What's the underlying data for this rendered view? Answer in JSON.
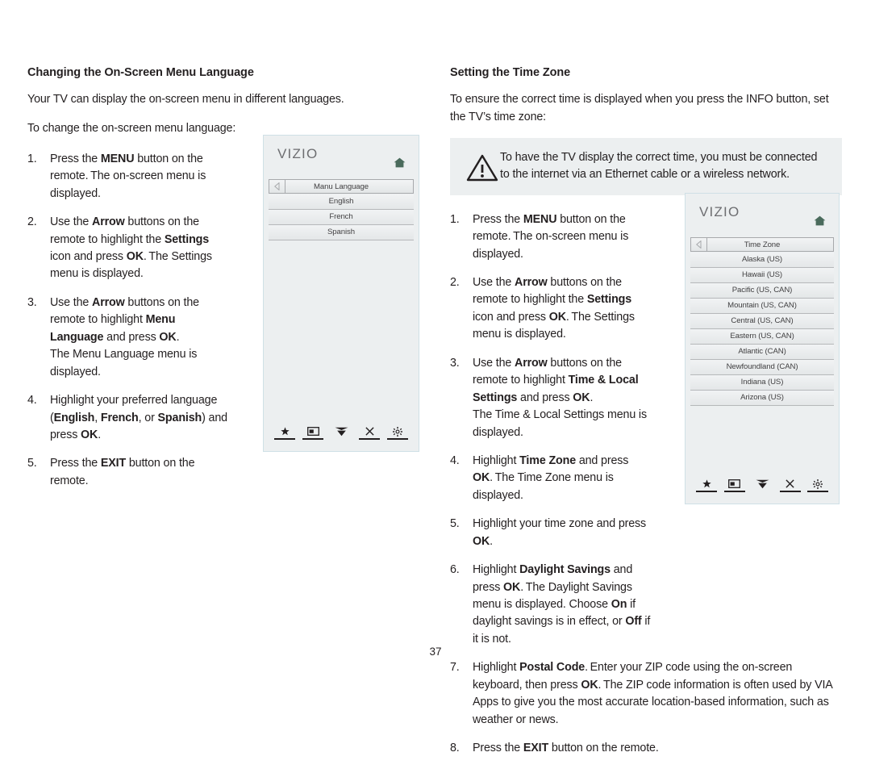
{
  "page": {
    "number": "37"
  },
  "left_column": {
    "title": "Changing the On-Screen Menu Language",
    "intro_1": "Your TV can display the on-screen menu in different languages.",
    "intro_2": "To change the on-screen menu language:",
    "steps": [
      {
        "num": "1.",
        "html": "Press the <b>MENU</b> button on the remote. The on-screen menu is displayed."
      },
      {
        "num": "2.",
        "html": "Use the <b>Arrow</b> buttons on the remote to highlight the <b>Settings</b> icon and press <b>OK</b>. The Settings menu is displayed."
      },
      {
        "num": "3.",
        "html": "Use the <b>Arrow</b> buttons on the remote to highlight <b>Menu Language</b> and press <b>OK</b>.<br>The Menu Language menu is displayed."
      },
      {
        "num": "4.",
        "html": "Highlight your preferred language (<b>English</b>, <b>French</b>, or <b>Spanish</b>) and press <b>OK</b>."
      },
      {
        "num": "5.",
        "html": "Press the <b>EXIT</b> button on the remote."
      }
    ]
  },
  "right_column": {
    "title": "Setting the Time Zone",
    "intro_1": "To ensure the correct time is displayed when you press the INFO button, set the TV’s time zone:",
    "note": {
      "icon": "warning-triangle-icon",
      "text": "To have the TV display the correct time, you must be connected to the internet via an Ethernet cable or a wireless network."
    },
    "steps_narrow": [
      {
        "num": "1.",
        "html": "Press the <b>MENU</b> button on the remote. The on-screen menu is displayed."
      },
      {
        "num": "2.",
        "html": "Use the <b>Arrow</b> buttons on the remote to highlight the <b>Settings</b> icon and press <b>OK</b>. The Settings menu is displayed."
      },
      {
        "num": "3.",
        "html": "Use the <b>Arrow</b> buttons on the remote to highlight <b>Time &amp; Local Settings</b> and press <b>OK</b>.<br>The Time &amp; Local Settings menu is displayed."
      },
      {
        "num": "4.",
        "html": "Highlight <b>Time Zone</b> and press <b>OK</b>. The Time Zone menu is displayed."
      },
      {
        "num": "5.",
        "html": "Highlight your time zone and press <b>OK</b>."
      },
      {
        "num": "6.",
        "html": "Highlight <b>Daylight Savings</b> and press <b>OK</b>. The Daylight Savings menu is displayed. Choose <b>On</b> if daylight savings is in effect, or <b>Off</b> if it is not."
      }
    ],
    "steps_wide": [
      {
        "num": "7.",
        "html": "Highlight <b>Postal Code</b>. Enter your ZIP code using the on-screen keyboard, then press <b>OK</b>. The ZIP code information is often used by VIA Apps to give you the most accurate location-based information, such as weather or news."
      },
      {
        "num": "8.",
        "html": "Press the <b>EXIT</b> button on the remote."
      }
    ]
  },
  "osd_language": {
    "logo": "VIZIO",
    "home_icon": "home-icon",
    "back_icon": "back-arrow-icon",
    "title_row": "Manu Language",
    "rows": [
      "English",
      "French",
      "Spanish"
    ],
    "footer_icons": [
      "star-icon",
      "picture-in-picture-icon",
      "double-chevron-down-icon",
      "close-x-icon",
      "gear-icon"
    ]
  },
  "osd_timezone": {
    "logo": "VIZIO",
    "home_icon": "home-icon",
    "back_icon": "back-arrow-icon",
    "title_row": "Time Zone",
    "rows": [
      "Alaska (US)",
      "Hawaii (US)",
      "Pacific (US, CAN)",
      "Mountain (US, CAN)",
      "Central (US, CAN)",
      "Eastern (US, CAN)",
      "Atlantic (CAN)",
      "Newfoundland (CAN)",
      "Indiana (US)",
      "Arizona (US)"
    ],
    "footer_icons": [
      "star-icon",
      "picture-in-picture-icon",
      "double-chevron-down-icon",
      "close-x-icon",
      "gear-icon"
    ]
  },
  "colors": {
    "text": "#231f20",
    "panel_bg": "#eceff0",
    "panel_border": "#cfe0e6",
    "row_border": "#b6b8ba",
    "logo_gray": "#6d6e71",
    "home_green": "#4a6b5c"
  }
}
